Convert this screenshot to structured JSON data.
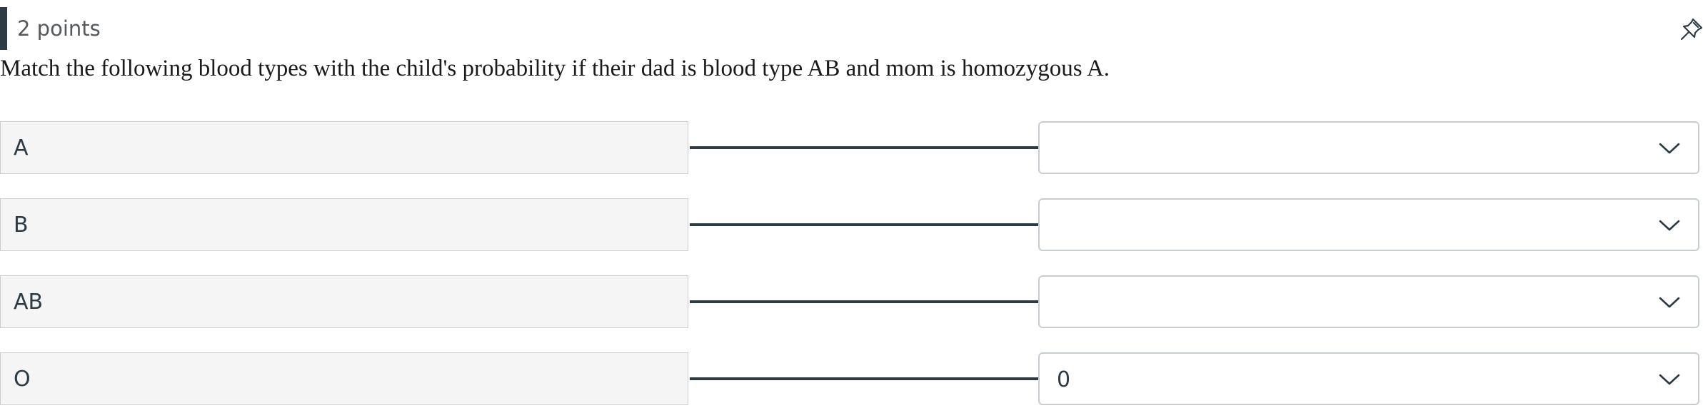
{
  "header": {
    "points": "2 points",
    "pin_icon": "pin-icon"
  },
  "question": {
    "text": "Match the following blood types with the child's probability if their dad is blood type AB and mom is homozygous A."
  },
  "rows": [
    {
      "label": "A",
      "selected": ""
    },
    {
      "label": "B",
      "selected": ""
    },
    {
      "label": "AB",
      "selected": ""
    },
    {
      "label": "O",
      "selected": "0"
    }
  ],
  "colors": {
    "accent": "#2d3b45",
    "left_box_bg": "#f5f5f5",
    "border": "#c7cdd1"
  },
  "icons": {
    "dropdown": "chevron-down-icon"
  }
}
